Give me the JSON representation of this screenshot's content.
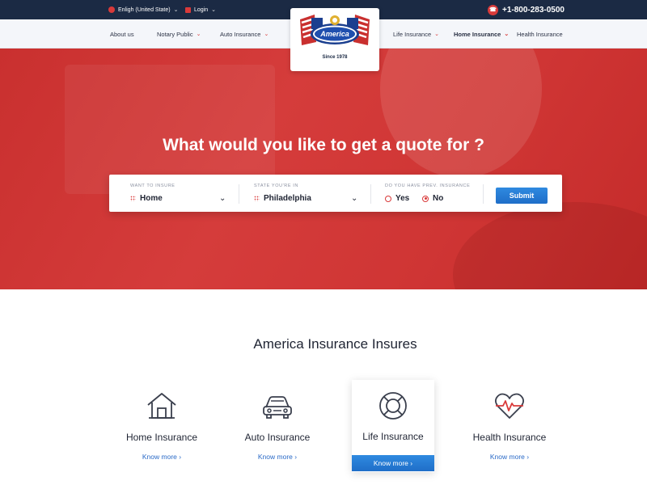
{
  "topbar": {
    "language": "Enligh (United State)",
    "login": "Login",
    "phone": "+1-800-283-0500"
  },
  "nav": {
    "left": [
      {
        "label": "About us",
        "has_dropdown": false
      },
      {
        "label": "Notary Public",
        "has_dropdown": true
      },
      {
        "label": "Auto Insurance",
        "has_dropdown": true
      }
    ],
    "right": [
      {
        "label": "Life Insurance",
        "has_dropdown": true
      },
      {
        "label": "Home Insurance",
        "has_dropdown": true,
        "active": true
      },
      {
        "label": "Health Insurance",
        "has_dropdown": false
      }
    ]
  },
  "logo": {
    "name": "America",
    "tagline": "Since 1978"
  },
  "hero": {
    "title": "What would you like to get a quote for ?"
  },
  "quote_form": {
    "insure": {
      "label": "WANT TO INSURE",
      "value": "Home"
    },
    "state": {
      "label": "STATE YOU'RE IN",
      "value": "Philadelphia"
    },
    "prev": {
      "label": "DO YOU HAVE PREV. INSURANCE",
      "yes": "Yes",
      "no": "No",
      "selected": "No"
    },
    "submit": "Submit"
  },
  "section": {
    "title": "America  Insurance Insures",
    "cards": [
      {
        "title": "Home Insurance",
        "link": "Know more",
        "icon": "house-icon"
      },
      {
        "title": "Auto Insurance",
        "link": "Know more",
        "icon": "car-icon"
      },
      {
        "title": "Life Insurance",
        "link": "Know more",
        "icon": "lifebuoy-icon",
        "featured": true
      },
      {
        "title": "Health Insurance",
        "link": "Know more",
        "icon": "heart-pulse-icon"
      }
    ]
  },
  "colors": {
    "accent_red": "#d93a3a",
    "navy": "#1b2a44",
    "button_blue": "#1f6ec8"
  }
}
